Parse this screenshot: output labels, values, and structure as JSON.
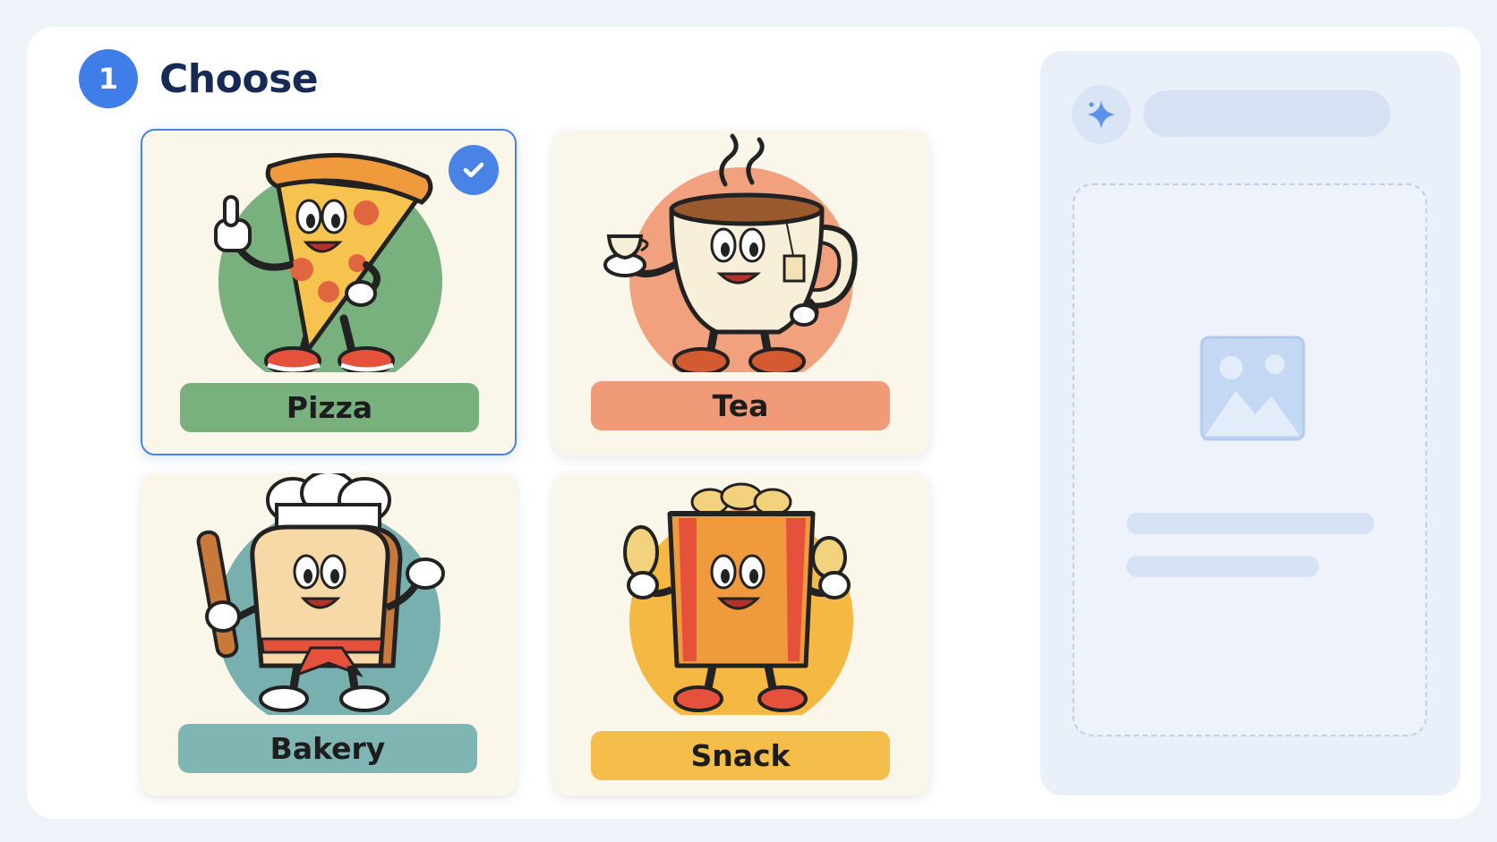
{
  "step": {
    "number": "1",
    "title": "Choose"
  },
  "options": [
    {
      "label": "Pizza",
      "label_color": "#78b07e",
      "circle_color": "#78b07e",
      "selected": true,
      "icon": "pizza-character"
    },
    {
      "label": "Tea",
      "label_color": "#f19a78",
      "circle_color": "#f2a17e",
      "selected": false,
      "icon": "tea-cup-character"
    },
    {
      "label": "Bakery",
      "label_color": "#7fb5b3",
      "circle_color": "#78b0b0",
      "selected": false,
      "icon": "bread-chef-character"
    },
    {
      "label": "Snack",
      "label_color": "#f5be4a",
      "circle_color": "#f5b843",
      "selected": false,
      "icon": "chips-bag-character"
    }
  ],
  "preview": {
    "icon": "sparkle-icon",
    "placeholder_icon": "image-placeholder-icon"
  }
}
